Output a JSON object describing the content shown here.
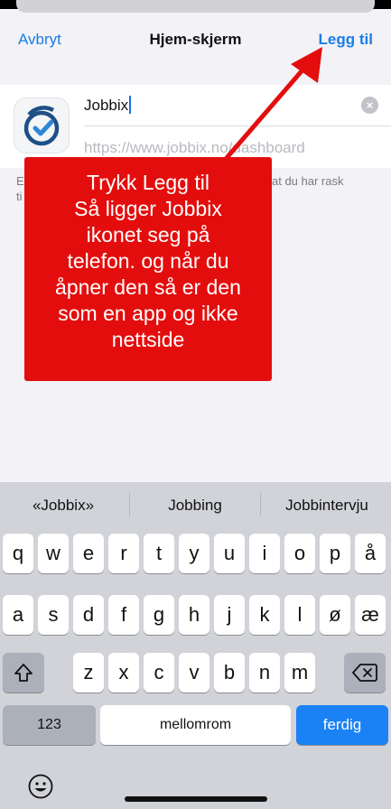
{
  "nav": {
    "cancel_label": "Avbryt",
    "title": "Hjem-skjerm",
    "add_label": "Legg til"
  },
  "form": {
    "app_name_value": "Jobbix",
    "url": "https://www.jobbix.no/dashboard",
    "icon": "jobbix-clock-logo"
  },
  "note": {
    "line1": "E",
    "line1_end": "at du har rask",
    "line2": "ti"
  },
  "callout": {
    "lines": [
      "Trykk Legg til",
      "Så ligger Jobbix",
      "ikonet seg på",
      "telefon. og når du",
      "åpner den så er den",
      "som en app og ikke",
      "nettside"
    ]
  },
  "keyboard": {
    "suggestions": [
      "«Jobbix»",
      "Jobbing",
      "Jobbintervju"
    ],
    "row1": [
      "q",
      "w",
      "e",
      "r",
      "t",
      "y",
      "u",
      "i",
      "o",
      "p",
      "å"
    ],
    "row2": [
      "a",
      "s",
      "d",
      "f",
      "g",
      "h",
      "j",
      "k",
      "l",
      "ø",
      "æ"
    ],
    "row3": [
      "z",
      "x",
      "c",
      "v",
      "b",
      "n",
      "m"
    ],
    "numbers_label": "123",
    "space_label": "mellomrom",
    "done_label": "ferdig"
  },
  "colors": {
    "accent": "#1a7de6",
    "callout": "#e40d0d",
    "done_key": "#1a82f5"
  }
}
